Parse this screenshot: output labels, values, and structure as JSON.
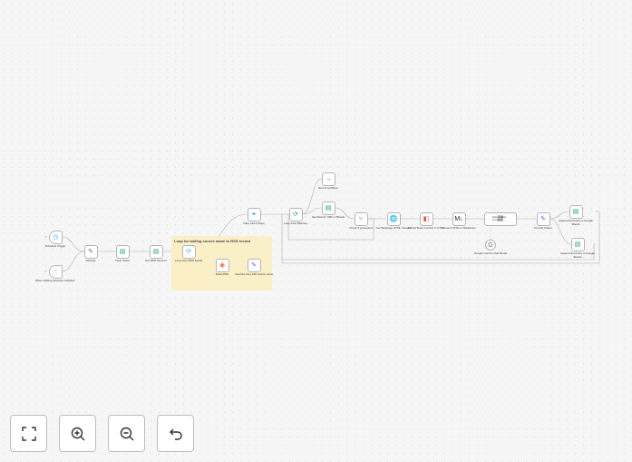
{
  "sticky_note": {
    "title": "Loop for adding source name to RSS record"
  },
  "nodes": [
    {
      "id": "schedule",
      "label": "Schedule Trigger",
      "sub": "",
      "icon": "clock-icon",
      "glyph": "◷",
      "color": "#3fa9f5",
      "shape": "trigger"
    },
    {
      "id": "manual",
      "label": "When clicking 'Execute workflow'",
      "sub": "",
      "icon": "cursor-click-icon",
      "glyph": "☝",
      "color": "#888888",
      "shape": "trigger"
    },
    {
      "id": "settings",
      "label": "Settings",
      "sub": "",
      "icon": "pencil-icon",
      "glyph": "✎",
      "color": "#6b5be0",
      "shape": "box"
    },
    {
      "id": "clear-sheet",
      "label": "Clear Sheet",
      "sub": "",
      "icon": "google-sheets-icon",
      "glyph": "▤",
      "color": "#1ea362",
      "shape": "box"
    },
    {
      "id": "get-rss-feed-url",
      "label": "Get RSS Feed url",
      "sub": "",
      "icon": "google-sheets-icon",
      "glyph": "▤",
      "color": "#1ea362",
      "shape": "box"
    },
    {
      "id": "loop-rss-feeds",
      "label": "Loop Over RSS Feeds",
      "sub": "",
      "icon": "loop-icon",
      "glyph": "⟳",
      "color": "#3fa9f5",
      "shape": "box"
    },
    {
      "id": "read-rss",
      "label": "Read RSS",
      "sub": "",
      "icon": "rss-icon",
      "glyph": "◉",
      "color": "#f26b3a",
      "shape": "box"
    },
    {
      "id": "combine-key",
      "label": "Combine Key with source name",
      "sub": "",
      "icon": "pencil-icon",
      "glyph": "✎",
      "color": "#6b5be0",
      "shape": "box"
    },
    {
      "id": "filter",
      "label": "Filter Last 6 Days",
      "sub": "",
      "icon": "filter-icon",
      "glyph": "⏷",
      "color": "#3fa9f5",
      "shape": "box"
    },
    {
      "id": "loop-batches",
      "label": "Loop Over Batches",
      "sub": "",
      "icon": "loop-icon",
      "glyph": "⟳",
      "color": "#1ea362",
      "shape": "box"
    },
    {
      "id": "end",
      "label": "End of workflow",
      "sub": "",
      "icon": "arrow-right-icon",
      "glyph": "→",
      "color": "#555555",
      "shape": "box"
    },
    {
      "id": "get-row",
      "label": "Get Row for URL in Sheets",
      "sub": "",
      "icon": "google-sheets-icon",
      "glyph": "▤",
      "color": "#1ea362",
      "shape": "box"
    },
    {
      "id": "check-processed",
      "label": "Check if processed",
      "sub": "",
      "icon": "if-icon",
      "glyph": "⑂",
      "color": "#1ea362",
      "shape": "box"
    },
    {
      "id": "get-webpage",
      "label": "Get Webpage HTML Content",
      "sub": "",
      "icon": "globe-icon",
      "glyph": "🌐",
      "color": "#3f5fa8",
      "shape": "box"
    },
    {
      "id": "extract-body",
      "label": "Extract Body Content in HTML",
      "sub": "",
      "icon": "html-icon",
      "glyph": "◧",
      "color": "#e0523c",
      "shape": "box"
    },
    {
      "id": "convert-md",
      "label": "Convert HTML to Markdown",
      "sub": "",
      "icon": "markdown-icon",
      "glyph": "M↓",
      "color": "#222222",
      "shape": "box"
    },
    {
      "id": "summarize",
      "label": "Summarize Content",
      "sub": "",
      "icon": "chain-link-icon",
      "glyph": "⛓",
      "color": "#555555",
      "shape": "wide"
    },
    {
      "id": "gemini",
      "label": "Google Gemini Chat Model",
      "sub": "",
      "icon": "google-icon",
      "glyph": "G",
      "color": "#666666",
      "shape": "circle"
    },
    {
      "id": "format-output",
      "label": "Format Output",
      "sub": "",
      "icon": "pencil-icon",
      "glyph": "✎",
      "color": "#6b5be0",
      "shape": "box"
    },
    {
      "id": "append-summary",
      "label": "Append Summary to Google Sheets",
      "sub": "",
      "icon": "google-sheets-icon",
      "glyph": "▤",
      "color": "#1ea362",
      "shape": "box"
    },
    {
      "id": "append-summary-2",
      "label": "Append Summary to Google Sheets",
      "sub": "",
      "icon": "google-sheets-icon",
      "glyph": "▤",
      "color": "#1ea362",
      "shape": "box"
    }
  ],
  "controls": [
    {
      "id": "fit-view-button",
      "icon": "fit-view-icon"
    },
    {
      "id": "zoom-in-button",
      "icon": "zoom-in-icon"
    },
    {
      "id": "zoom-out-button",
      "icon": "zoom-out-icon"
    },
    {
      "id": "undo-button",
      "icon": "undo-icon"
    }
  ]
}
